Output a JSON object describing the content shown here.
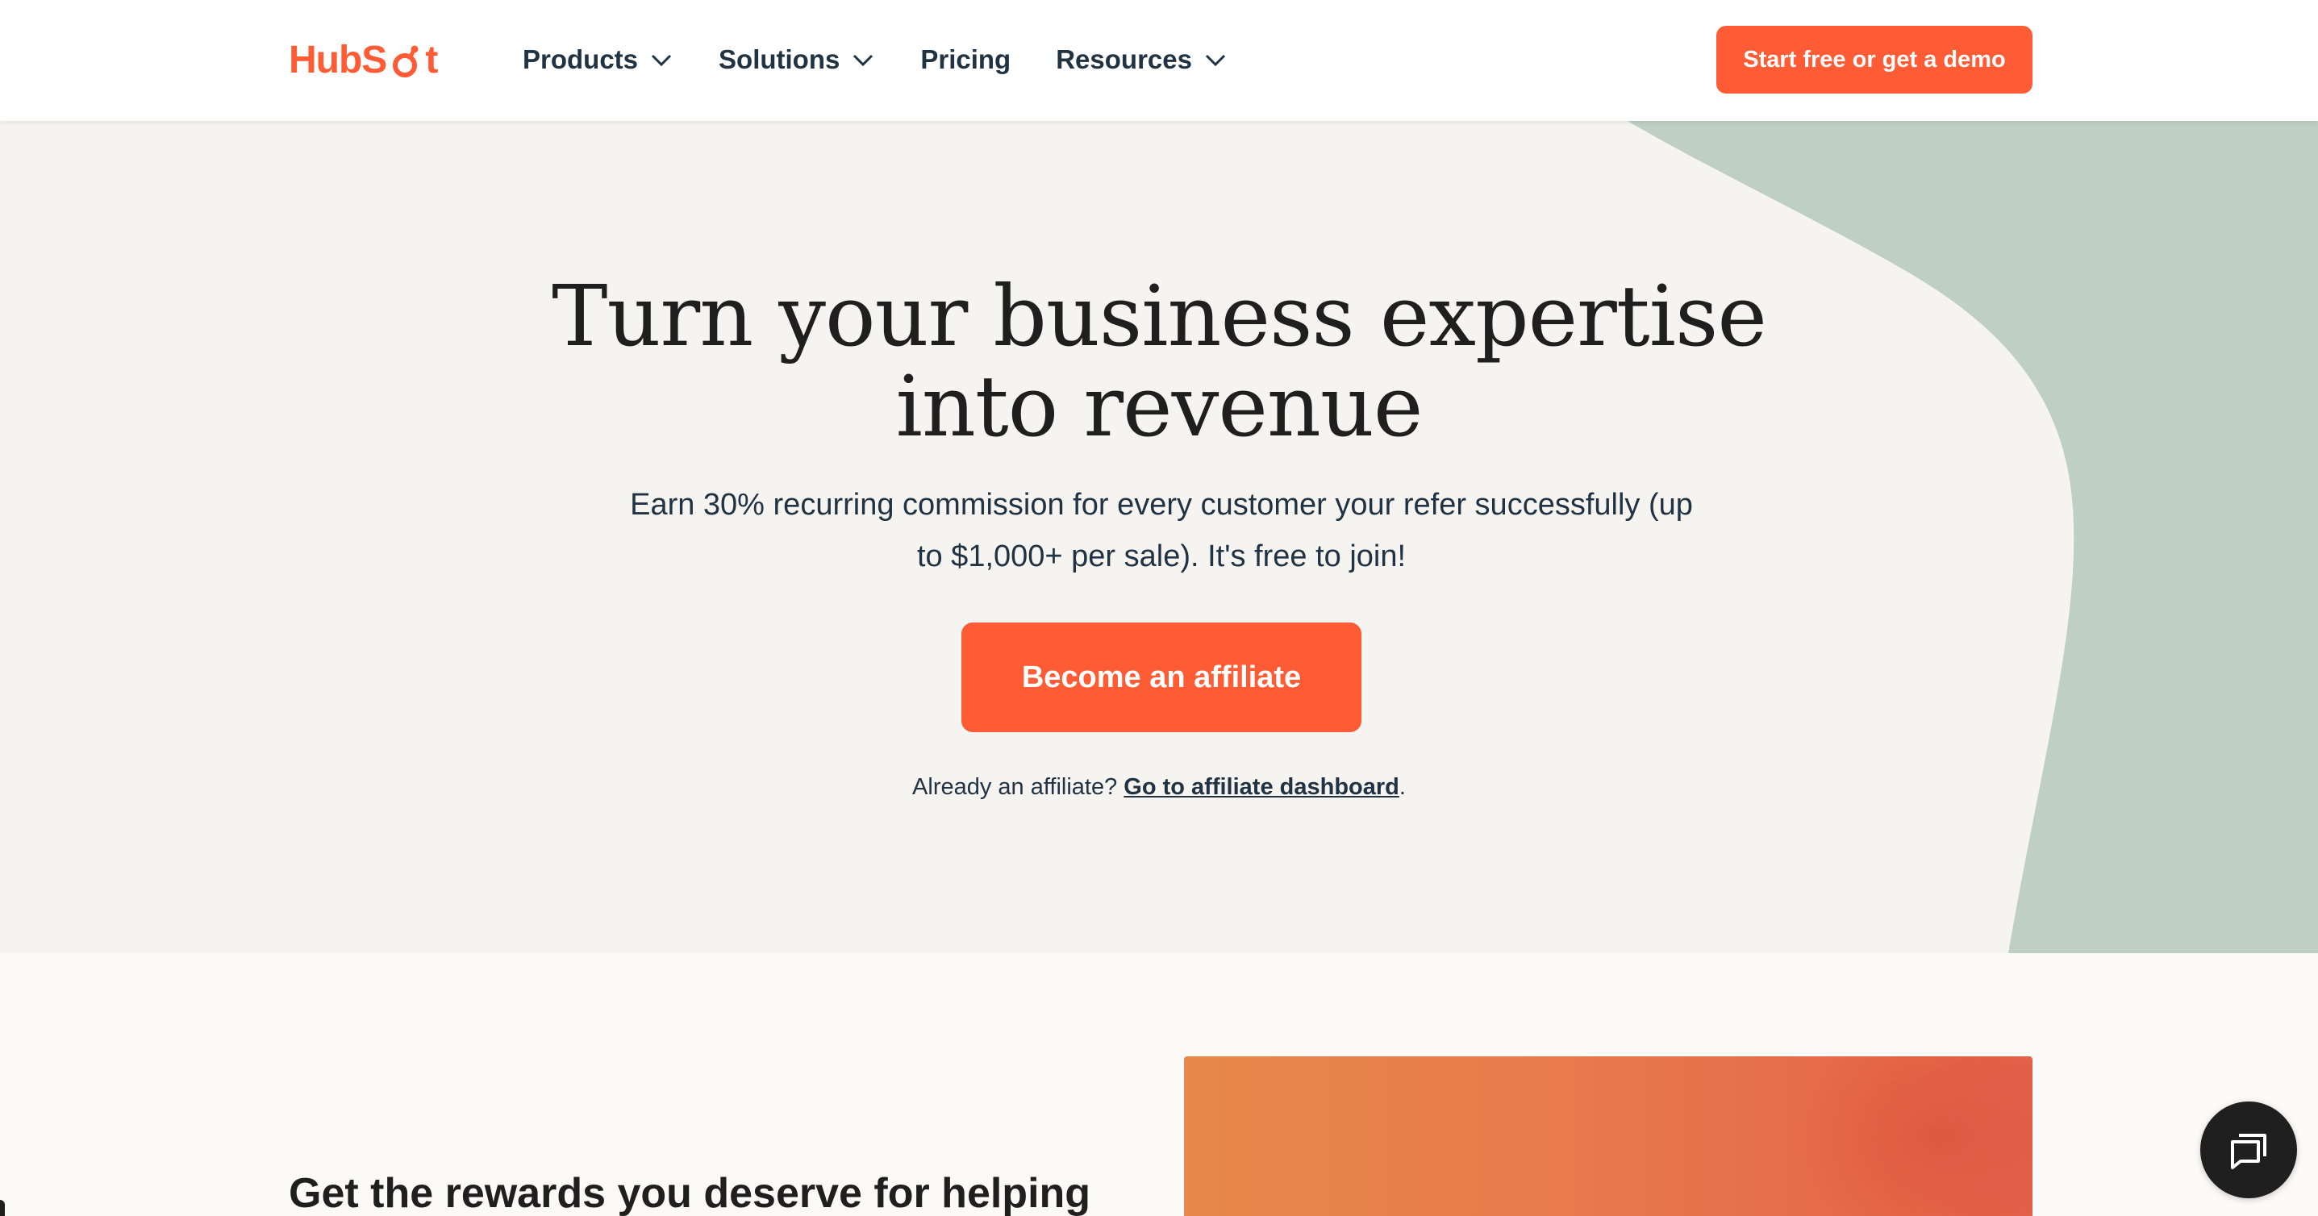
{
  "header": {
    "logo_text": "HubSpot",
    "nav": [
      {
        "label": "Products",
        "has_dropdown": true,
        "icon": "chevron-down-icon"
      },
      {
        "label": "Solutions",
        "has_dropdown": true,
        "icon": "chevron-down-icon"
      },
      {
        "label": "Pricing",
        "has_dropdown": false
      },
      {
        "label": "Resources",
        "has_dropdown": true,
        "icon": "chevron-down-icon"
      }
    ],
    "cta_label": "Start free or get a demo"
  },
  "hero": {
    "title_line1": "Turn your business expertise",
    "title_line2": "into revenue",
    "subtitle": "Earn 30% recurring commission for every customer your refer successfully (up to $1,000+ per sale). It's free to join!",
    "button_label": "Become an affiliate",
    "already_text": "Already an affiliate? ",
    "dashboard_link": "Go to affiliate dashboard",
    "already_end": "."
  },
  "section2": {
    "heading": "Get the rewards you deserve for helping"
  },
  "chat": {
    "icon": "chat-icon"
  },
  "colors": {
    "brand_orange": "#ff5c35",
    "hero_bg": "#f6f4f0",
    "hero_shape": "#bfcfc2",
    "text_dark": "#213343"
  }
}
